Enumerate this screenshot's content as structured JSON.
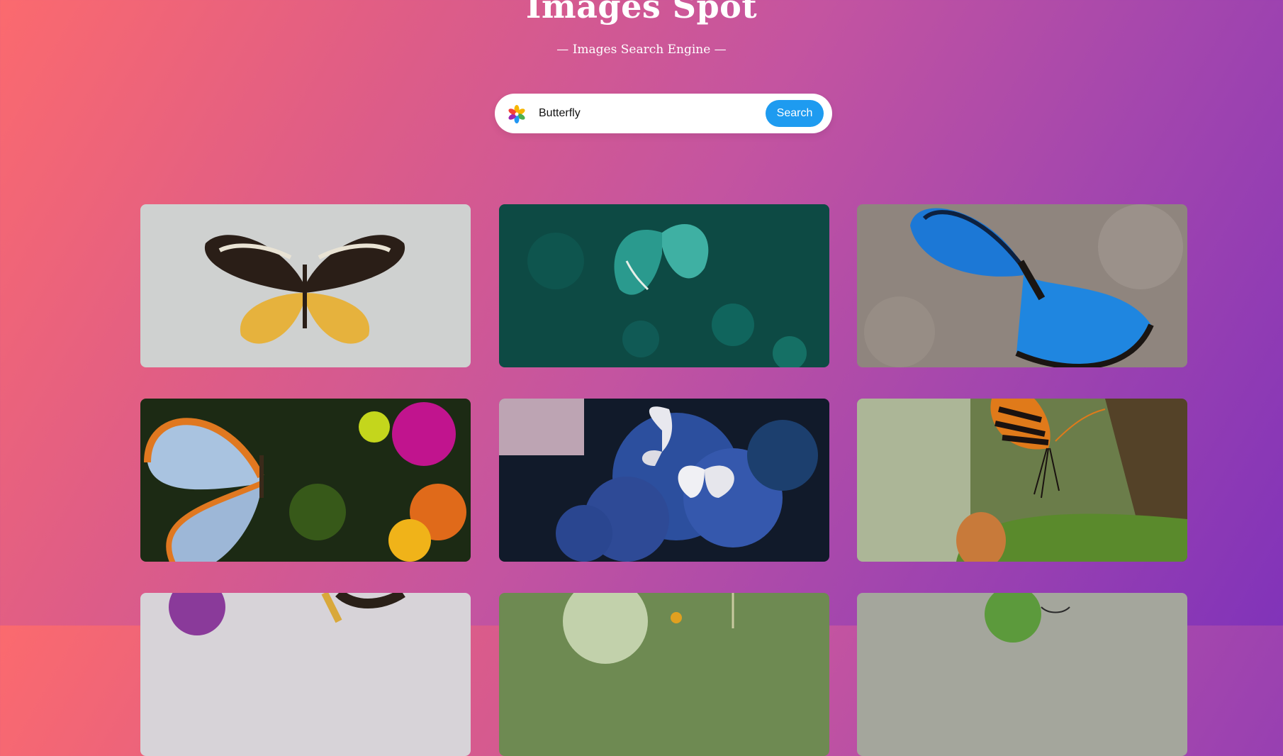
{
  "header": {
    "title": "Images Spot",
    "subtitle": "— Images Search Engine —"
  },
  "search": {
    "value": "Butterfly",
    "placeholder": "",
    "button_label": "Search",
    "icon": "colorful-flower-icon"
  },
  "results": [
    {
      "name": "result-image-1",
      "subject": "butterfly-icon"
    },
    {
      "name": "result-image-2",
      "subject": "butterfly-icon"
    },
    {
      "name": "result-image-3",
      "subject": "butterfly-icon"
    },
    {
      "name": "result-image-4",
      "subject": "butterfly-icon"
    },
    {
      "name": "result-image-5",
      "subject": "butterfly-icon"
    },
    {
      "name": "result-image-6",
      "subject": "butterfly-icon"
    },
    {
      "name": "result-image-7",
      "subject": "butterfly-icon"
    },
    {
      "name": "result-image-8",
      "subject": "butterfly-icon"
    },
    {
      "name": "result-image-9",
      "subject": "butterfly-icon"
    }
  ],
  "colors": {
    "gradient_start": "#fb6a6e",
    "gradient_end": "#8133b9",
    "search_button": "#1e9bf0"
  }
}
